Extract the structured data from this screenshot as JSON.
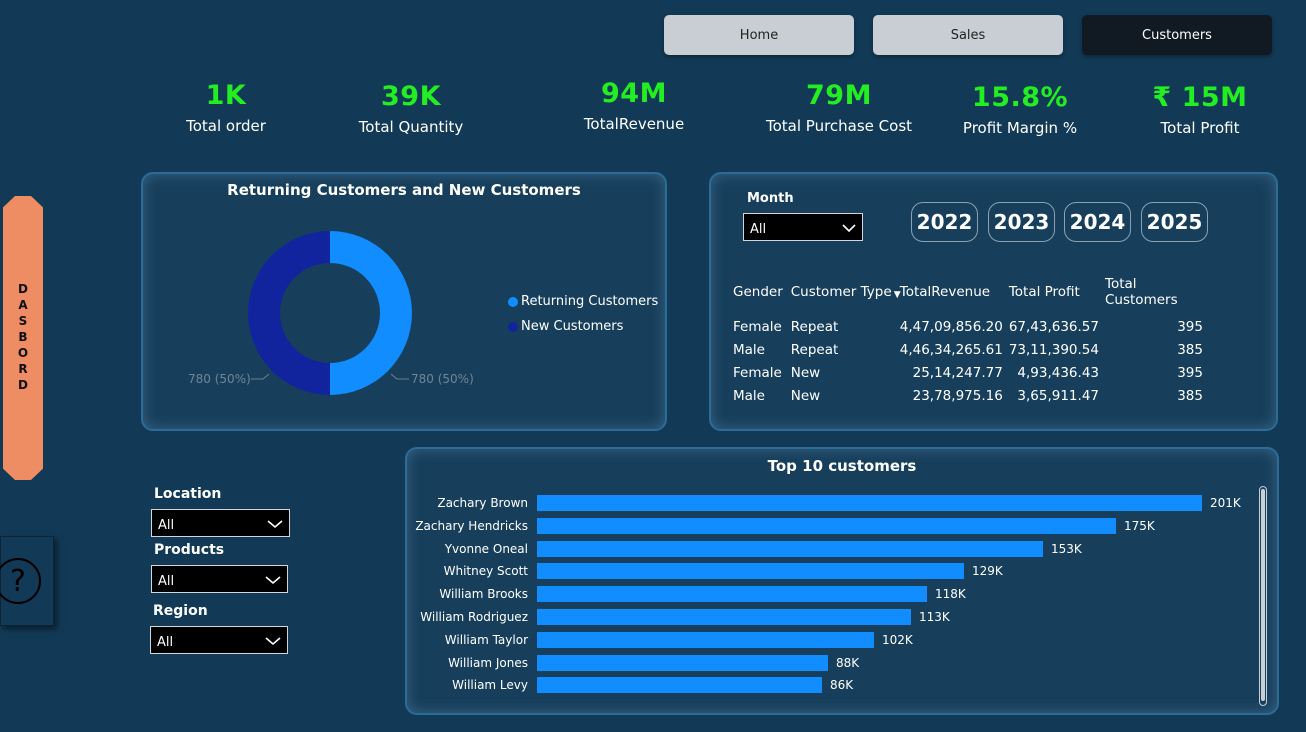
{
  "nav": [
    {
      "label": "Home",
      "active": false
    },
    {
      "label": "Sales",
      "active": false
    },
    {
      "label": "Customers",
      "active": true
    }
  ],
  "kpis": [
    {
      "value": "1K",
      "label": "Total order"
    },
    {
      "value": "39K",
      "label": "Total Quantity"
    },
    {
      "value": "94M",
      "label": "TotalRevenue"
    },
    {
      "value": "79M",
      "label": "Total Purchase Cost"
    },
    {
      "value": "15.8%",
      "label": "Profit Margin %"
    },
    {
      "value": "₹ 15M",
      "label": "Total Profit"
    }
  ],
  "side": {
    "dashboard_label": "DASBORD",
    "help_icon": "question-circle-icon"
  },
  "donut": {
    "title": "Returning Customers and New Customers",
    "left_label": "780 (50%)",
    "right_label": "780 (50%)",
    "legend": [
      {
        "label": "Returning Customers",
        "color": "#118dff"
      },
      {
        "label": "New Customers",
        "color": "#12239e"
      }
    ]
  },
  "month_slicer": {
    "label": "Month",
    "value": "All"
  },
  "years": [
    "2022",
    "2023",
    "2024",
    "2025"
  ],
  "table": {
    "headers": [
      "Gender",
      "Customer Type",
      "TotalRevenue",
      "Total Profit",
      "Total Customers"
    ],
    "rows": [
      [
        "Female",
        "Repeat",
        "4,47,09,856.20",
        "67,43,636.57",
        "395"
      ],
      [
        "Male",
        "Repeat",
        "4,46,34,265.61",
        "73,11,390.54",
        "385"
      ],
      [
        "Female",
        "New",
        "25,14,247.77",
        "4,93,436.43",
        "395"
      ],
      [
        "Male",
        "New",
        "23,78,975.16",
        "3,65,911.47",
        "385"
      ]
    ]
  },
  "filters": [
    {
      "label": "Location",
      "value": "All"
    },
    {
      "label": "Products",
      "value": "All"
    },
    {
      "label": "Region",
      "value": "All"
    }
  ],
  "chart_data": {
    "type": "bar",
    "orientation": "horizontal",
    "title": "Top 10 customers",
    "categories": [
      "Zachary Brown",
      "Zachary Hendricks",
      "Yvonne Oneal",
      "Whitney Scott",
      "William Brooks",
      "William Rodriguez",
      "William Taylor",
      "William Jones",
      "William Levy"
    ],
    "values": [
      201,
      175,
      153,
      129,
      118,
      113,
      102,
      88,
      86
    ],
    "value_labels": [
      "201K",
      "175K",
      "153K",
      "129K",
      "118K",
      "113K",
      "102K",
      "88K",
      "86K"
    ],
    "color": "#118dff",
    "xlim": [
      0,
      201
    ]
  },
  "colors": {
    "background": "#123a56",
    "kpi": "#22ee22",
    "accent": "#118dff",
    "dashboard_tab": "#ee8c63"
  }
}
